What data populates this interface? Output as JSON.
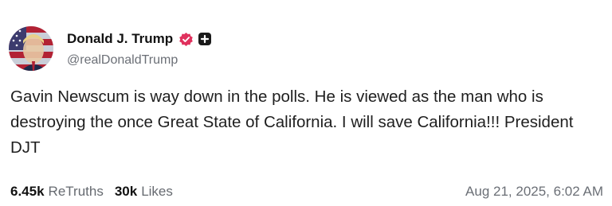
{
  "author": {
    "display_name": "Donald J. Trump",
    "handle": "@realDonaldTrump",
    "verified_icon": "verified-check-badge",
    "verified_color": "#e0315d",
    "extra_badge_icon": "plus-square-badge"
  },
  "post": {
    "text": "Gavin Newscum is way down in the polls. He is viewed as the man who is destroying the once Great State of California. I will save California!!! President DJT"
  },
  "stats": {
    "retruths_count": "6.45k",
    "retruths_label": "ReTruths",
    "likes_count": "30k",
    "likes_label": "Likes"
  },
  "timestamp": "Aug 21, 2025, 6:02 AM"
}
